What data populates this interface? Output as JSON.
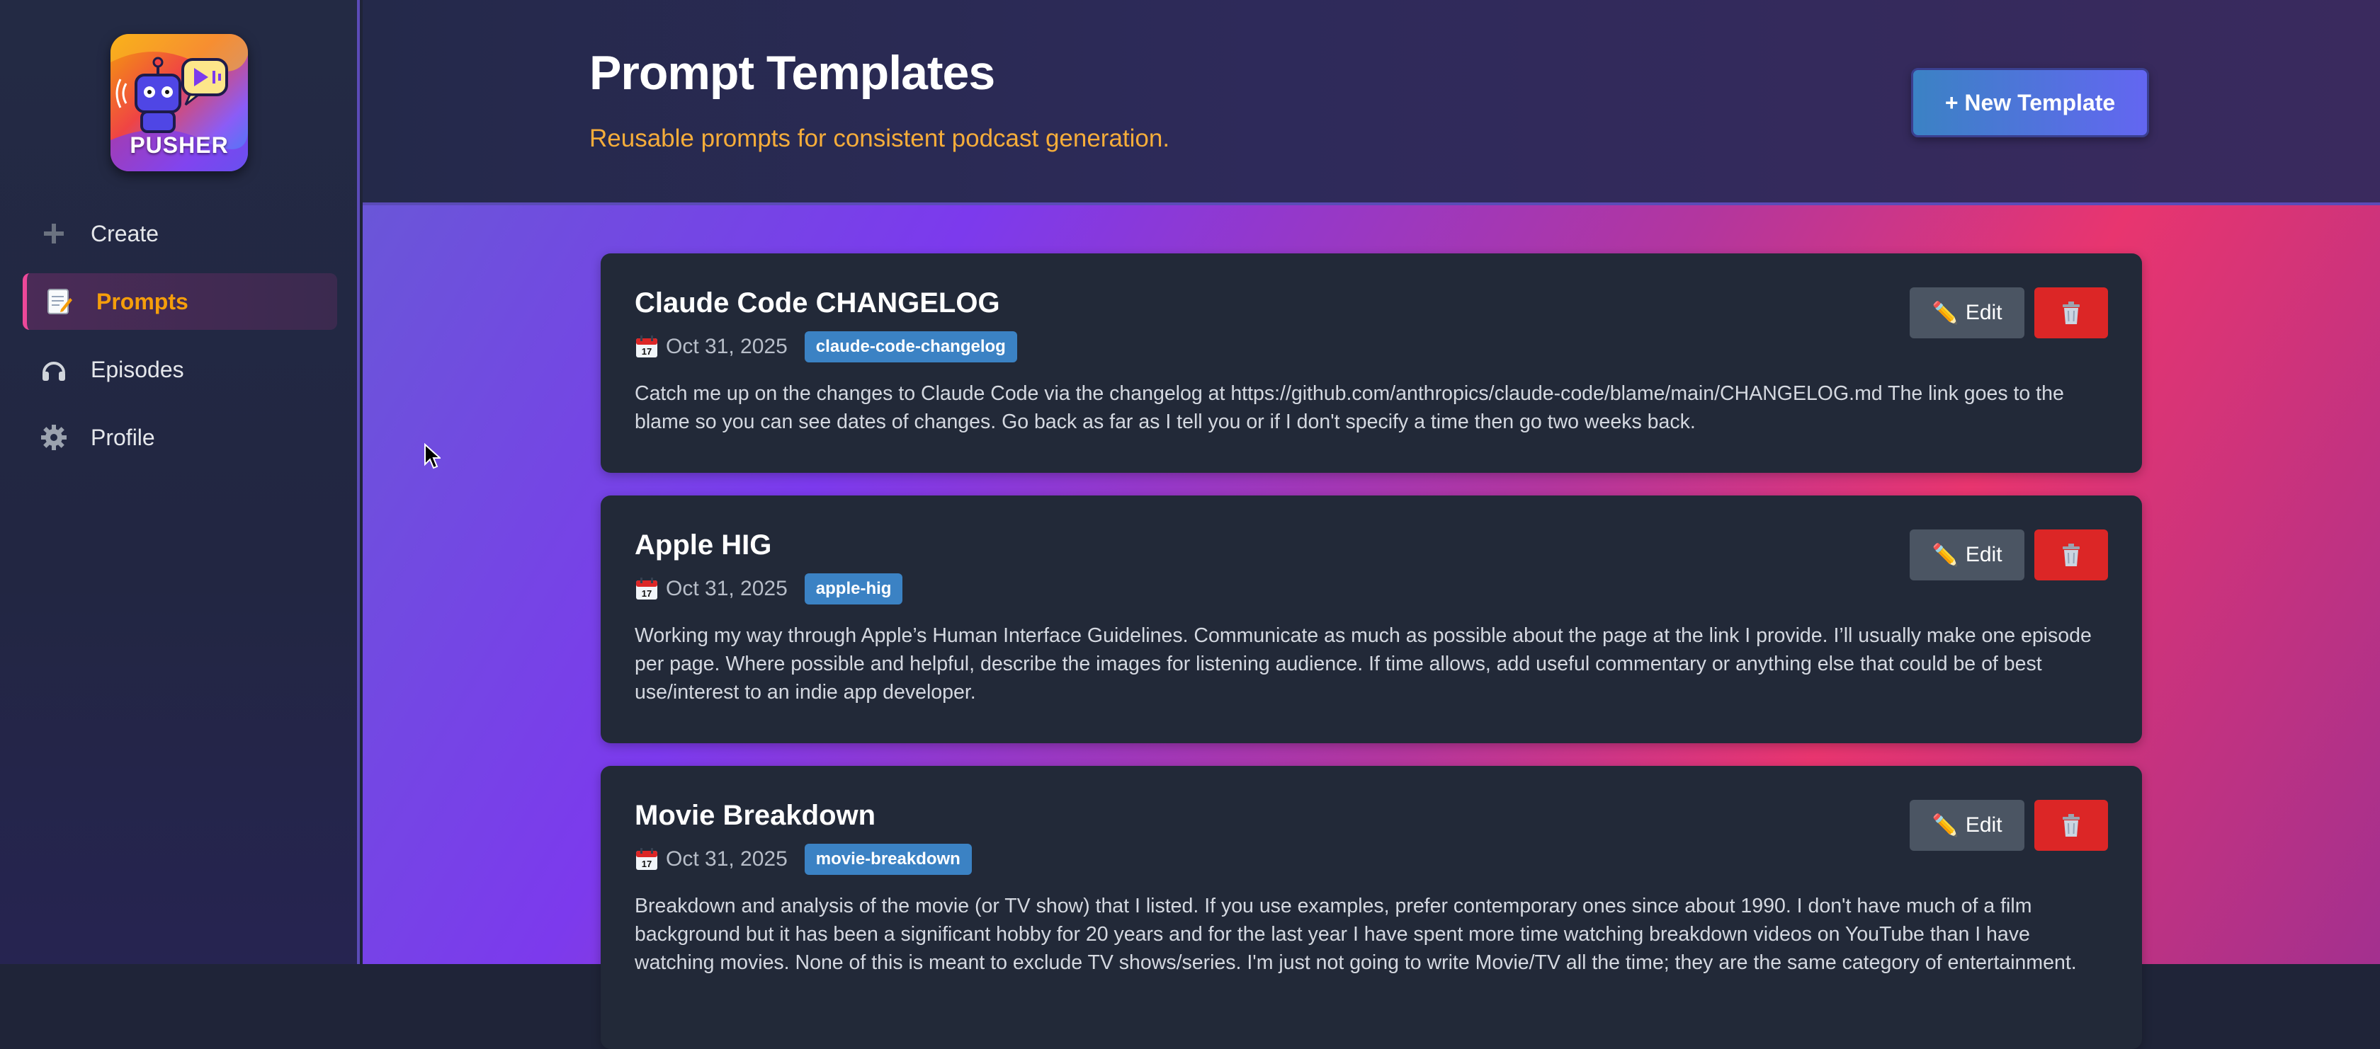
{
  "app": {
    "logo_text": "PUSHER"
  },
  "sidebar": {
    "items": [
      {
        "label": "Create",
        "icon": "plus-icon",
        "active": false
      },
      {
        "label": "Prompts",
        "icon": "memo-icon",
        "active": true
      },
      {
        "label": "Episodes",
        "icon": "headphones-icon",
        "active": false
      },
      {
        "label": "Profile",
        "icon": "gear-icon",
        "active": false
      }
    ]
  },
  "header": {
    "title": "Prompt Templates",
    "subtitle": "Reusable prompts for consistent podcast generation.",
    "new_button": "+ New Template"
  },
  "templates": [
    {
      "title": "Claude Code CHANGELOG",
      "date": "Oct 31, 2025",
      "tag": "claude-code-changelog",
      "body": "Catch me up on the changes to Claude Code via the changelog at https://github.com/anthropics/claude-code/blame/main/CHANGELOG.md The link goes to the blame so you can see dates of changes. Go back as far as I tell you or if I don't specify a time then go two weeks back."
    },
    {
      "title": "Apple HIG",
      "date": "Oct 31, 2025",
      "tag": "apple-hig",
      "body": "Working my way through Apple’s Human Interface Guidelines. Communicate as much as possible about the page at the link I provide. I’ll usually make one episode per page. Where possible and helpful, describe the images for listening audience. If time allows, add useful commentary or anything else that could be of best use/interest to an indie app developer."
    },
    {
      "title": "Movie Breakdown",
      "date": "Oct 31, 2025",
      "tag": "movie-breakdown",
      "body": "Breakdown and analysis of the movie (or TV show) that I listed. If you use examples, prefer contemporary ones since about 1990. I don't have much of a film background but it has been a significant hobby for 20 years and for the last year I have spent more time watching breakdown videos on YouTube than I have watching movies. None of this is meant to exclude TV shows/series. I'm just not going to write Movie/TV all the time; they are the same category of entertainment."
    }
  ],
  "card_actions": {
    "edit_label": "Edit",
    "edit_icon": "pencil-icon",
    "delete_icon": "trash-icon"
  },
  "colors": {
    "accent": "#f59e0b",
    "active_border": "#ec4899",
    "tag": "#3b82c4",
    "delete": "#dc2626"
  }
}
